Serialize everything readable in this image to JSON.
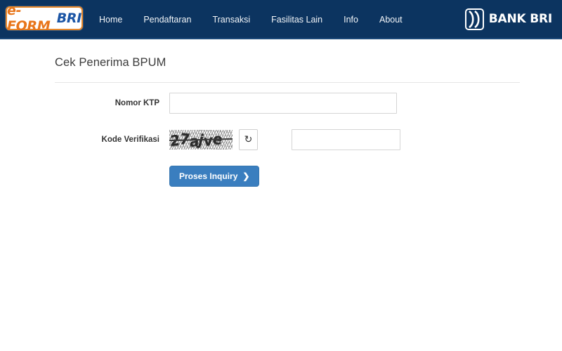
{
  "navbar": {
    "brand": {
      "eform_text": "e-FORM",
      "bri_text": "BRI"
    },
    "links": [
      {
        "label": "Home"
      },
      {
        "label": "Pendaftaran"
      },
      {
        "label": "Transaksi"
      },
      {
        "label": "Fasilitas Lain"
      },
      {
        "label": "Info"
      },
      {
        "label": "About"
      }
    ],
    "bank_logo": {
      "text": "BANK BRI",
      "mark_icon": "bri-chevrons-icon"
    },
    "background_color": "#0c3460"
  },
  "page": {
    "title": "Cek Penerima BPUM"
  },
  "form": {
    "ktp": {
      "label": "Nomor KTP",
      "value": "",
      "placeholder": ""
    },
    "kode_verifikasi": {
      "label": "Kode Verifikasi",
      "captcha_text": "27ajve",
      "refresh_icon": "refresh-icon",
      "refresh_glyph": "↻",
      "value": "",
      "placeholder": ""
    },
    "submit": {
      "label": "Proses Inquiry",
      "chevron": "❯",
      "color": "#3a7ebf"
    }
  }
}
